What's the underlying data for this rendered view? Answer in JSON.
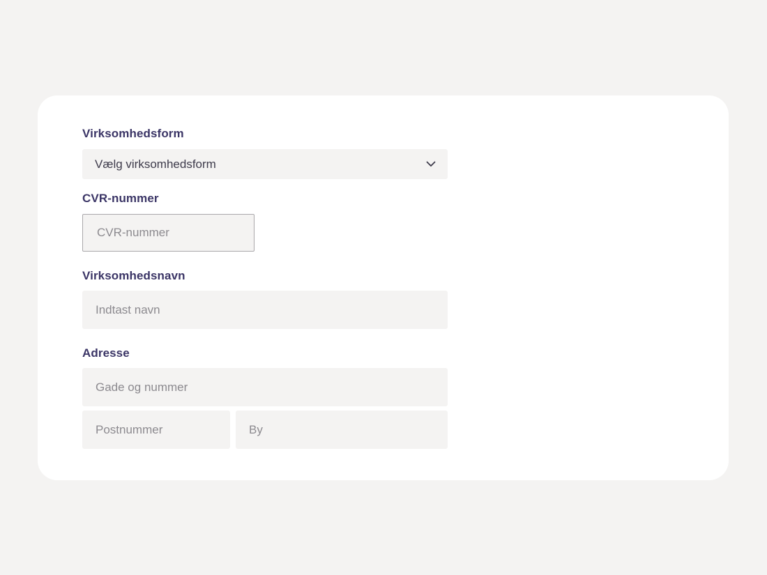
{
  "form": {
    "company_type": {
      "label": "Virksomhedsform",
      "selected": "Vælg virksomhedsform",
      "icon": "chevron-down-icon"
    },
    "cvr": {
      "label": "CVR-nummer",
      "placeholder": "CVR-nummer"
    },
    "company_name": {
      "label": "Virksomhedsnavn",
      "placeholder": "Indtast navn"
    },
    "address": {
      "label": "Adresse",
      "street_placeholder": "Gade og nummer",
      "postal_placeholder": "Postnummer",
      "city_placeholder": "By"
    }
  },
  "colors": {
    "page_background": "#f4f3f2",
    "card_background": "#ffffff",
    "label_text": "#3b3566",
    "placeholder_text": "#8c8a8f",
    "field_background": "#f4f3f2"
  }
}
